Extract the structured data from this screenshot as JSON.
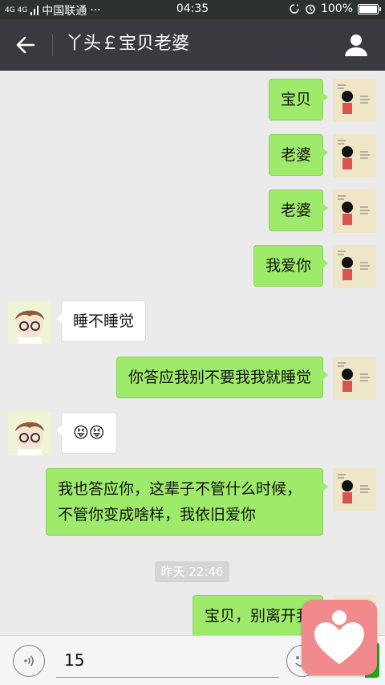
{
  "status_bar": {
    "network": "4G 4G",
    "carrier": "中国联通",
    "more": "···",
    "time": "04:35",
    "battery": "100%"
  },
  "header": {
    "title": "丫头￡宝贝老婆",
    "background": "#393a3f"
  },
  "messages": [
    {
      "from": "me",
      "text": "宝贝"
    },
    {
      "from": "me",
      "text": "老婆"
    },
    {
      "from": "me",
      "text": "老婆"
    },
    {
      "from": "me",
      "text": "我爱你"
    },
    {
      "from": "other",
      "text": "睡不睡觉"
    },
    {
      "from": "me",
      "text": "你答应我别不要我我就睡觉"
    },
    {
      "from": "other",
      "text": "😝😝"
    },
    {
      "from": "me",
      "text": "我也答应你，这辈子不管什么时候，不管你变成啥样，我依旧爱你"
    },
    {
      "from": "me",
      "text": "宝贝，别离开我"
    }
  ],
  "timestamp": "昨天 22:46",
  "input": {
    "value": "15"
  },
  "colors": {
    "sent_bubble": "#9eea6a",
    "recv_bubble": "#ffffff",
    "chat_bg": "#ebebeb",
    "floating_app": "#f08a8d"
  },
  "icons": {
    "back": "arrow-left-icon",
    "profile": "person-icon",
    "voice": "voice-icon",
    "emoji": "emoji-icon",
    "floating": "heart-icon"
  }
}
